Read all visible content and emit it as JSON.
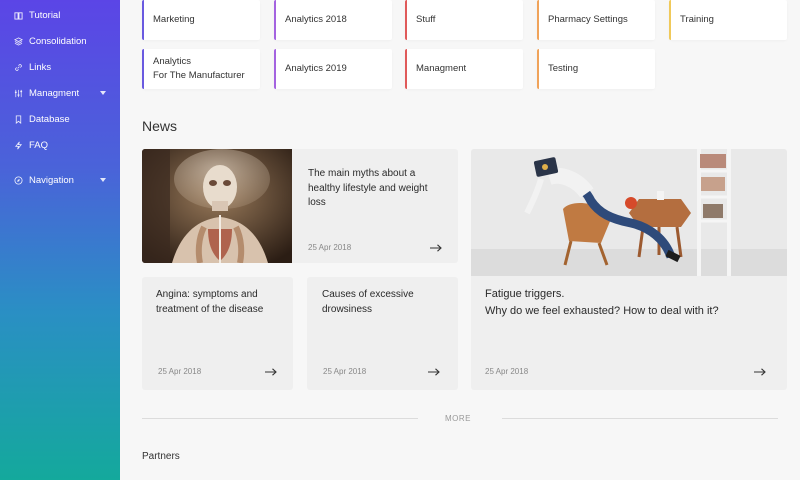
{
  "sidebar": {
    "items": [
      {
        "label": "Tutorial",
        "icon": "book-icon"
      },
      {
        "label": "Consolidation",
        "icon": "layers-icon"
      },
      {
        "label": "Links",
        "icon": "link-icon"
      },
      {
        "label": "Managment",
        "icon": "sliders-icon",
        "has_dropdown": true
      },
      {
        "label": "Database",
        "icon": "bookmark-icon"
      },
      {
        "label": "FAQ",
        "icon": "bolt-icon"
      },
      {
        "label": "Navigation",
        "icon": "compass-icon",
        "has_dropdown": true
      }
    ]
  },
  "tiles": [
    {
      "label": "Marketing",
      "accent": "#6a5ae0"
    },
    {
      "label": "Analytics 2018",
      "accent": "#a463e0"
    },
    {
      "label": "Stuff",
      "accent": "#e05a5a"
    },
    {
      "label": "Pharmacy Settings",
      "accent": "#f0a35a"
    },
    {
      "label": "Training",
      "accent": "#f0c95a"
    },
    {
      "label": "Analytics\nFor The Manufacturer",
      "accent": "#6a5ae0"
    },
    {
      "label": "Analytics 2019",
      "accent": "#a463e0"
    },
    {
      "label": "Managment",
      "accent": "#e05a5a"
    },
    {
      "label": "Testing",
      "accent": "#f0a35a"
    }
  ],
  "news": {
    "title": "News",
    "cards": [
      {
        "title": "The main myths about a healthy lifestyle and weight loss",
        "date": "25 Apr 2018"
      },
      {
        "title": "Angina: symptoms and treatment of the disease",
        "date": "25 Apr 2018"
      },
      {
        "title": "Causes of excessive drowsiness",
        "date": "25 Apr 2018"
      },
      {
        "title": "Fatigue triggers.\nWhy do we feel exhausted? How to deal with it?",
        "date": "25 Apr 2018"
      }
    ],
    "more_label": "MORE"
  },
  "partners": {
    "title": "Partners"
  }
}
